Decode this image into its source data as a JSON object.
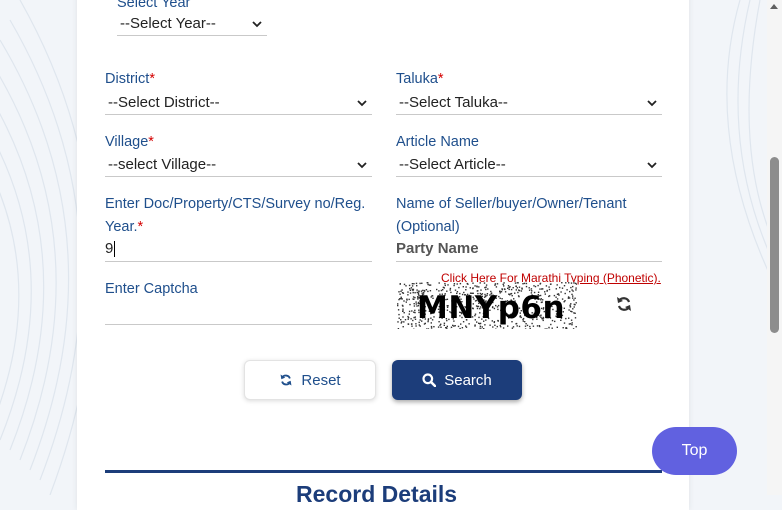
{
  "form": {
    "year_label": "Select Year",
    "year_value": "--Select Year--",
    "district_label": "District",
    "district_value": "--Select District--",
    "taluka_label": "Taluka",
    "taluka_value": "--Select Taluka--",
    "village_label": "Village",
    "village_value": "--select Village--",
    "article_label": "Article Name",
    "article_value": "--Select Article--",
    "doc_label_line1": "Enter Doc/Property/CTS/Survey no/Reg.",
    "doc_label_line2": "Year.",
    "doc_value": "9",
    "party_label_line1": "Name of Seller/buyer/Owner/Tenant",
    "party_label_line2": "(Optional)",
    "party_placeholder": "Party Name",
    "captcha_label": "Enter Captcha",
    "captcha_value": "",
    "required_mark": "*"
  },
  "captcha": {
    "marathi_link": "Click Here For Marathi Typing (Phonetic).",
    "text": "MNYp6n"
  },
  "buttons": {
    "reset": "Reset",
    "search": "Search",
    "top": "Top"
  },
  "section": {
    "title": "Record Details"
  },
  "colors": {
    "label": "#1f4f8c",
    "required": "#d40000",
    "primary": "#1c3d7a",
    "top_button": "#6161e0"
  }
}
